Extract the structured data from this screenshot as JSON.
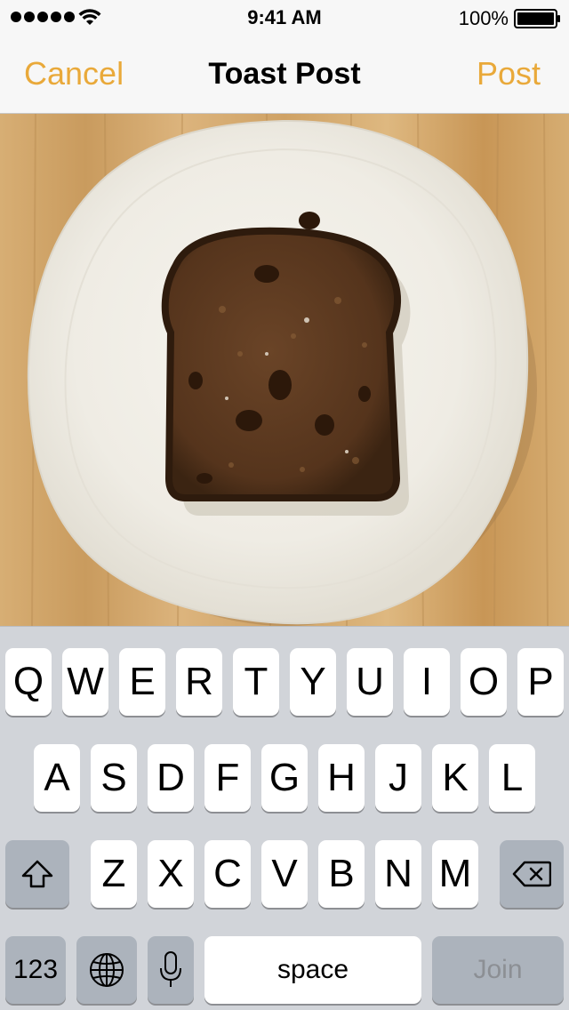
{
  "status_bar": {
    "time": "9:41 AM",
    "battery_percent": "100%",
    "signal_bars": 5,
    "battery_level": 1.0
  },
  "nav": {
    "cancel_label": "Cancel",
    "title": "Toast Post",
    "post_label": "Post",
    "accent_color": "#e9a93a"
  },
  "photo": {
    "icon": "toast-photo"
  },
  "keyboard": {
    "row1": [
      "Q",
      "W",
      "E",
      "R",
      "T",
      "Y",
      "U",
      "I",
      "O",
      "P"
    ],
    "row2": [
      "A",
      "S",
      "D",
      "F",
      "G",
      "H",
      "J",
      "K",
      "L"
    ],
    "row3": [
      "Z",
      "X",
      "C",
      "V",
      "B",
      "N",
      "M"
    ],
    "numbers_label": "123",
    "space_label": "space",
    "return_label": "Join",
    "shift_icon": "shift-icon",
    "delete_icon": "backspace-icon",
    "globe_icon": "globe-icon",
    "mic_icon": "microphone-icon"
  }
}
